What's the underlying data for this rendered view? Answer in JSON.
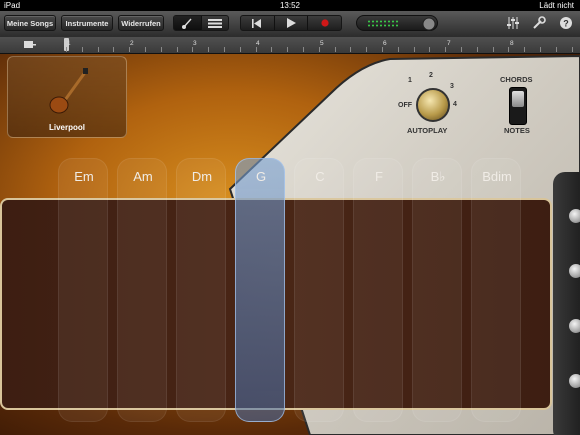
{
  "status": {
    "device": "iPad",
    "time": "13:52",
    "battery": "Lädt nicht"
  },
  "toolbar": {
    "my_songs": "Meine Songs",
    "instruments": "Instrumente",
    "undo": "Widerrufen"
  },
  "ruler": {
    "marks": [
      "1",
      "2",
      "3",
      "4",
      "5",
      "6",
      "7",
      "8"
    ]
  },
  "instrument": {
    "name": "Liverpool"
  },
  "autoplay": {
    "label": "AUTOPLAY",
    "off": "OFF",
    "positions": [
      "1",
      "2",
      "3",
      "4"
    ]
  },
  "mode_switch": {
    "chords": "CHORDS",
    "notes": "NOTES"
  },
  "chords": [
    "Em",
    "Am",
    "Dm",
    "G",
    "C",
    "F",
    "B♭",
    "Bdim"
  ],
  "selected_chord": "G"
}
